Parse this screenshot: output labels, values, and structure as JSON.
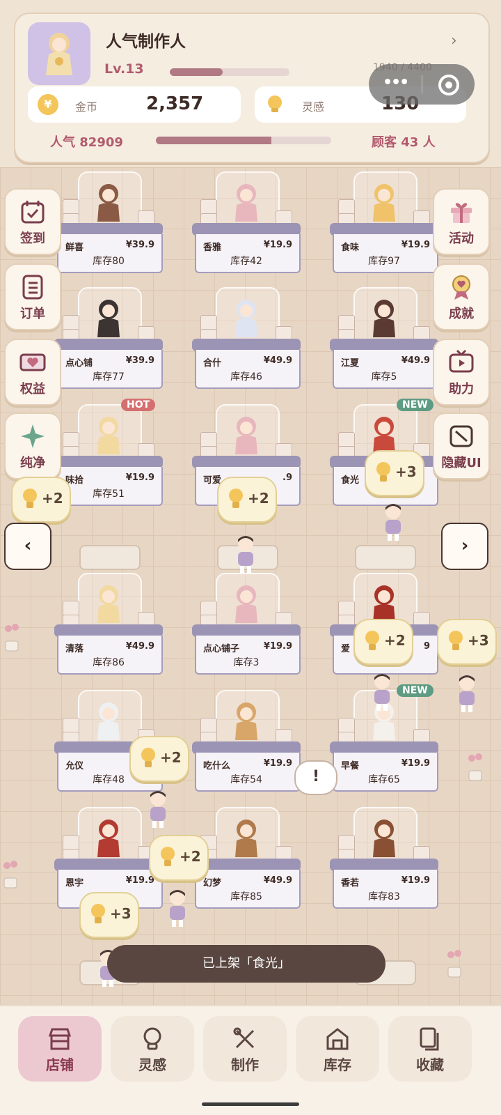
{
  "header": {
    "title": "人气制作人",
    "level": "Lv.13",
    "xp_text": "1940 / 4400",
    "xp_progress": 0.44,
    "coin_label": "金币",
    "coin_value": "2,357",
    "idea_label": "灵感",
    "idea_value": "130",
    "popularity": "人气 82909",
    "popularity_progress": 0.66,
    "customers": "顾客 43 人",
    "chevron": "›"
  },
  "left_menu": [
    {
      "label": "签到",
      "icon": "calendar-check-icon"
    },
    {
      "label": "订单",
      "icon": "order-list-icon"
    },
    {
      "label": "权益",
      "icon": "heart-ticket-icon"
    },
    {
      "label": "纯净",
      "icon": "sparkle-icon"
    }
  ],
  "right_menu": [
    {
      "label": "活动",
      "icon": "gift-icon"
    },
    {
      "label": "成就",
      "icon": "badge-icon"
    },
    {
      "label": "助力",
      "icon": "tv-icon"
    },
    {
      "label": "隐藏UI",
      "icon": "hide-ui-icon"
    }
  ],
  "shelves": [
    {
      "name": "鲜喜",
      "price": "¥39.9",
      "stock": "库存80",
      "tag": ""
    },
    {
      "name": "香雅",
      "price": "¥19.9",
      "stock": "库存42",
      "tag": ""
    },
    {
      "name": "食味",
      "price": "¥19.9",
      "stock": "库存97",
      "tag": ""
    },
    {
      "name": "点心铺",
      "price": "¥39.9",
      "stock": "库存77",
      "tag": ""
    },
    {
      "name": "合什",
      "price": "¥49.9",
      "stock": "库存46",
      "tag": ""
    },
    {
      "name": "江夏",
      "price": "¥49.9",
      "stock": "库存5",
      "tag": ""
    },
    {
      "name": "味拾",
      "price": "¥19.9",
      "stock": "库存51",
      "tag": "HOT"
    },
    {
      "name": "可爱",
      "price": ".9",
      "stock": "",
      "tag": ""
    },
    {
      "name": "食光",
      "price": "",
      "stock": "库",
      "tag": "NEW"
    },
    {
      "name": "清落",
      "price": "¥49.9",
      "stock": "库存86",
      "tag": ""
    },
    {
      "name": "点心铺子",
      "price": "¥19.9",
      "stock": "库存3",
      "tag": ""
    },
    {
      "name": "爱",
      "price": "9",
      "stock": "",
      "tag": ""
    },
    {
      "name": "允仪",
      "price": "¥2",
      "stock": "库存48",
      "tag": ""
    },
    {
      "name": "吃什么",
      "price": "¥19.9",
      "stock": "库存54",
      "tag": ""
    },
    {
      "name": "早餐",
      "price": "¥19.9",
      "stock": "库存65",
      "tag": "NEW"
    },
    {
      "name": "恩宇",
      "price": "¥19.9",
      "stock": "",
      "tag": ""
    },
    {
      "name": "幻梦",
      "price": "¥49.9",
      "stock": "库存85",
      "tag": ""
    },
    {
      "name": "香若",
      "price": "¥19.9",
      "stock": "库存83",
      "tag": ""
    }
  ],
  "bubbles": [
    "+2",
    "+2",
    "+3",
    "+2",
    "+3",
    "+2",
    "+2",
    "+3"
  ],
  "nav_arrows": {
    "left": "‹",
    "right": "›"
  },
  "alert": "!",
  "toast": "已上架「食光」",
  "bottom_nav": [
    {
      "label": "店铺",
      "icon": "store-icon",
      "active": true
    },
    {
      "label": "灵感",
      "icon": "lightbulb-icon",
      "active": false
    },
    {
      "label": "制作",
      "icon": "tools-icon",
      "active": false
    },
    {
      "label": "库存",
      "icon": "warehouse-icon",
      "active": false
    },
    {
      "label": "收藏",
      "icon": "collection-icon",
      "active": false
    }
  ],
  "colors": {
    "accent": "#b25b6e",
    "nav_active": "#ecc9d1",
    "toast": "#5a4640"
  }
}
